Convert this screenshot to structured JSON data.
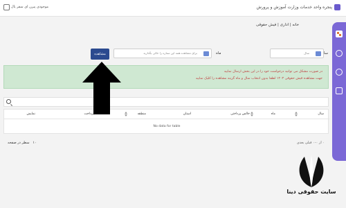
{
  "topbar": {
    "title": "پنجره واحد خدمات وزارت آموزش و پرورش",
    "user": "موجودی پیرن ای سفر یال"
  },
  "sidebar": {
    "icons": [
      "dashboard-icon",
      "user-add-icon",
      "users-icon",
      "document-icon"
    ]
  },
  "breadcrumb": "خانه | اداری | فیش حقوقی",
  "filters": {
    "year_label": "سال",
    "year_value": "سال",
    "month_label": "ماه",
    "month_value": "برای مشاهده همه این ستاره را خالی بگذارید",
    "view_button": "مشاهده"
  },
  "message": {
    "line1": "در صورت مشکل می توانید درخواست خود را در این بخش ارسال نمایید",
    "line2": "جهت مشاهده فیش حقوقی ۱۴۰۳ لطفا بدون انتخاب سال و ماه گزینه مشاهده را کلیک نمایید"
  },
  "table": {
    "columns": [
      "سال",
      "ماه",
      "خالص پرداختی",
      "استان",
      "منطقه",
      "پرداخت",
      "نمایش"
    ],
    "empty_text": "No data for table"
  },
  "pager": {
    "per_page_value": "۱۰",
    "per_page_label": "سطر در صفحه",
    "nav_text": "۰ از ۰-۰    قبلی    بعدی"
  },
  "watermark": {
    "text": "سایت حقوقی دینا"
  },
  "colors": {
    "sidebar": "#7b68d6",
    "button": "#2b4a8f",
    "message_bg": "#cfe8d2",
    "message_text": "#c04040"
  }
}
